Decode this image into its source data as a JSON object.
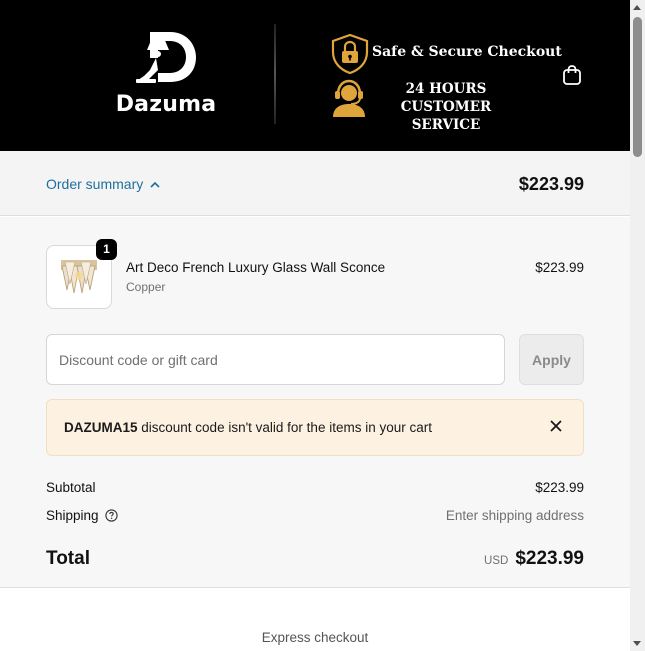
{
  "header": {
    "brand": "Dazuma",
    "badge_secure": "Safe & Secure Checkout",
    "badge_service": "24 HOURS CUSTOMER SERVICE",
    "cart_icon": "shopping-bag-icon"
  },
  "summary": {
    "toggle_label": "Order summary",
    "toggle_icon": "chevron-up-icon",
    "total": "$223.99"
  },
  "product": {
    "quantity": "1",
    "name": "Art Deco French Luxury Glass Wall Sconce",
    "variant": "Copper",
    "price": "$223.99"
  },
  "discount": {
    "placeholder": "Discount code or gift card",
    "apply_label": "Apply"
  },
  "alert": {
    "code": "DAZUMA15",
    "message": " discount code isn't valid for the items in your cart",
    "close_icon": "close-icon"
  },
  "totals": {
    "subtotal_label": "Subtotal",
    "subtotal_value": "$223.99",
    "shipping_label": "Shipping",
    "shipping_value": "Enter shipping address",
    "total_label": "Total",
    "currency": "USD",
    "total_value": "$223.99"
  },
  "express": {
    "label": "Express checkout"
  },
  "colors": {
    "header_bg": "#000000",
    "accent_gold": "#e0a53a",
    "link_blue": "#1f6f9e",
    "alert_bg": "#fdf2e2"
  }
}
